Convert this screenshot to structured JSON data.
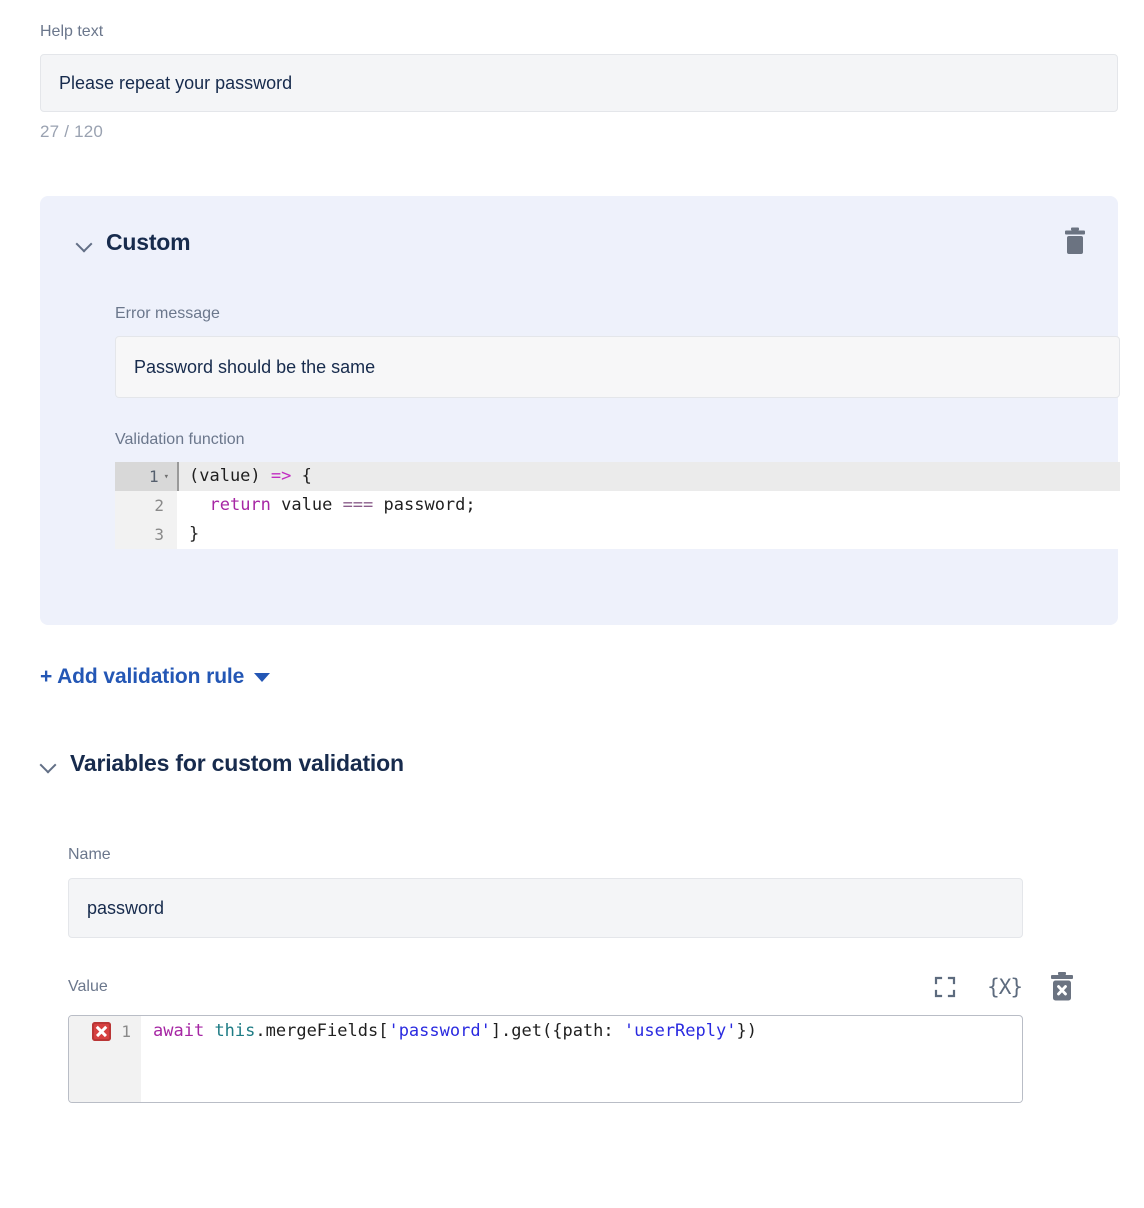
{
  "help": {
    "label": "Help text",
    "value": "Please repeat your password",
    "placeholder": "Help text",
    "counter": "27 / 120"
  },
  "custom_panel": {
    "title": "Custom",
    "chevron_icon": "chevron-down-icon",
    "delete_icon": "trash-icon",
    "error_message": {
      "label": "Error message",
      "value": "Password should be the same",
      "placeholder": "Error message"
    },
    "validation_function": {
      "label": "Validation function",
      "lines": [
        {
          "num": "1",
          "fold": "▾",
          "active": true
        },
        {
          "num": "2",
          "fold": "",
          "active": false
        },
        {
          "num": "3",
          "fold": "",
          "active": false
        }
      ],
      "code": {
        "l1_a": "(value) ",
        "l1_arrow": "=>",
        "l1_b": " {",
        "l2_indent": "  ",
        "l2_kw": "return",
        "l2_a": " value ",
        "l2_op": "===",
        "l2_b": " password;",
        "l3": "}"
      }
    }
  },
  "add_rule": {
    "label": "+ Add validation rule",
    "caret_icon": "caret-down-icon"
  },
  "variables": {
    "title": "Variables for custom validation",
    "chevron_icon": "chevron-down-icon",
    "name": {
      "label": "Name",
      "value": "password",
      "placeholder": "Name"
    },
    "value": {
      "label": "Value",
      "expand_icon": "fullscreen-icon",
      "braces_icon": "{X}",
      "delete_icon": "trash-x-icon",
      "line_number": "1",
      "error_icon": "error-x-icon",
      "code": {
        "await": "await",
        "sp1": " ",
        "this": "this",
        "member": ".mergeFields[",
        "str1": "'password'",
        "mid": "].get({path: ",
        "str2": "'userReply'",
        "end": "})"
      }
    }
  },
  "colors": {
    "panel_bg": "#eef1fb",
    "input_bg": "#f4f5f7",
    "link": "#2457b5",
    "label": "#6b778c",
    "text": "#172b4d",
    "error": "#d64040"
  }
}
